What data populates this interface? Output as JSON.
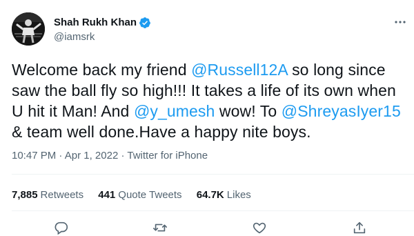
{
  "author": {
    "display_name": "Shah Rukh Khan",
    "handle": "@iamsrk",
    "verified_icon": "verified-badge-icon"
  },
  "tweet": {
    "segments": [
      {
        "text": "Welcome back my friend ",
        "mention": false
      },
      {
        "text": "@Russell12A",
        "mention": true
      },
      {
        "text": " so long since saw the ball fly so high!!! It takes a life of its own when U hit it Man! And ",
        "mention": false
      },
      {
        "text": "@y_umesh",
        "mention": true
      },
      {
        "text": " wow! To ",
        "mention": false
      },
      {
        "text": "@ShreyasIyer15",
        "mention": true
      },
      {
        "text": " & team well done.Have a happy nite boys.",
        "mention": false
      }
    ],
    "time": "10:47 PM",
    "separator": " · ",
    "date": "Apr 1, 2022",
    "source": "Twitter for iPhone"
  },
  "stats": {
    "retweets_count": "7,885",
    "retweets_label": "Retweets",
    "quotes_count": "441",
    "quotes_label": "Quote Tweets",
    "likes_count": "64.7K",
    "likes_label": "Likes"
  },
  "colors": {
    "mention": "#1d9bf0",
    "secondary_text": "#536471",
    "primary_text": "#0f1419",
    "divider": "#eff3f4",
    "verified": "#1d9bf0"
  },
  "icons": {
    "more": "more-dots-icon",
    "reply": "reply-icon",
    "retweet": "retweet-icon",
    "like": "heart-icon",
    "share": "share-icon"
  }
}
